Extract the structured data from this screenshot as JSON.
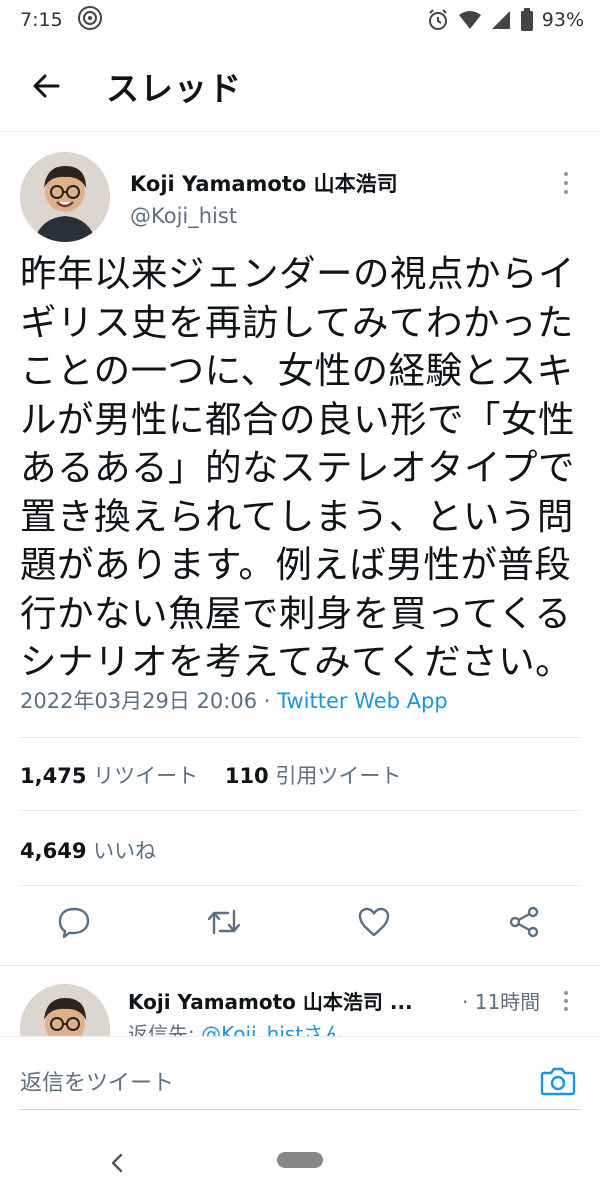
{
  "status_bar": {
    "time": "7:15",
    "battery": "93%",
    "icons": [
      "alarm-icon",
      "wifi-icon",
      "signal-icon",
      "battery-icon"
    ]
  },
  "header": {
    "title": "スレッド"
  },
  "tweet": {
    "author_name": "Koji Yamamoto 山本浩司",
    "author_handle": "@Koji_hist",
    "text_lines": [
      "昨年以来ジェンダーの視点からイ",
      "ギリス史を再訪してみてわかった",
      "ことの一つに、女性の経験とスキ",
      "ルが男性に都合の良い形で「女性",
      "あるある」的なステレオタイプで",
      "置き換えられてしまう、という問",
      "題があります。例えば男性が普段",
      "行かない魚屋で刺身を買ってくる",
      "シナリオを考えてみてください。"
    ],
    "timestamp": "2022年03月29日 20:06",
    "separator": " · ",
    "source_app": "Twitter Web App",
    "retweets_count": "1,475",
    "retweets_label": "リツイート",
    "quotes_count": "110",
    "quotes_label": "引用ツイート",
    "likes_count": "4,649",
    "likes_label": "いいね"
  },
  "reply": {
    "author_name": "Koji Yamamoto 山本浩司 ...",
    "time": "· 11時間",
    "reply_to_label": "返信先: ",
    "reply_to_link": "@Koji_histさん"
  },
  "compose": {
    "placeholder": "返信をツイート"
  },
  "colors": {
    "text_primary": "#0f1419",
    "text_secondary": "#5b7083",
    "link": "#1b95e0",
    "divider": "#e6ecf0"
  }
}
